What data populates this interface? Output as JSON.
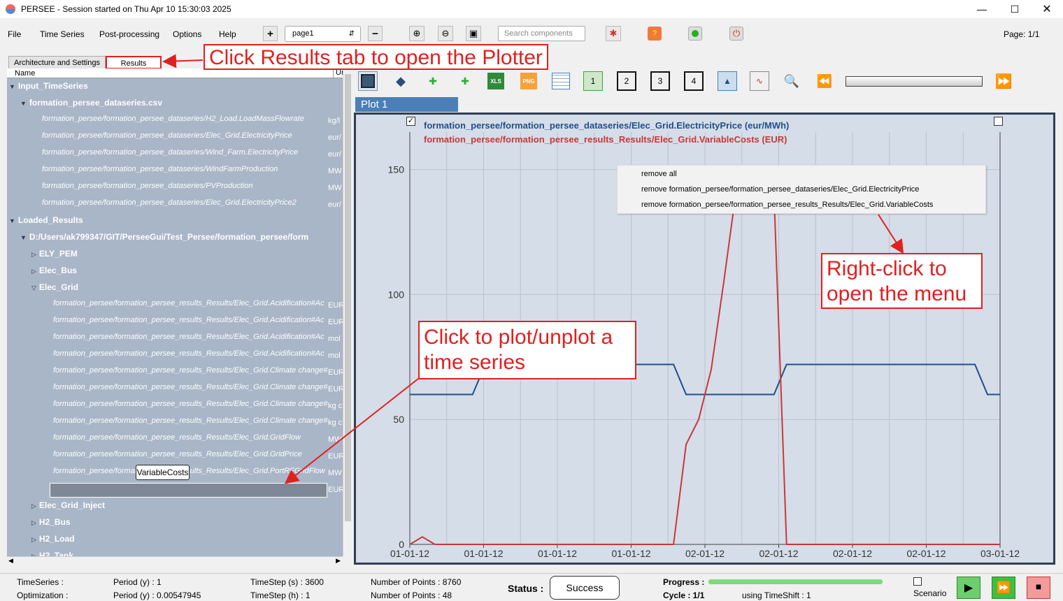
{
  "window": {
    "title": "PERSEE - Session started on Thu Apr 10 15:30:03 2025"
  },
  "menu": [
    "File",
    "Time Series",
    "Post-processing",
    "Options",
    "Help"
  ],
  "toolbar": {
    "page_select": "page1",
    "search_placeholder": "Search components",
    "page_info": "Page: 1/1"
  },
  "tabs": [
    {
      "label": "Architecture and Settings"
    },
    {
      "label": "Results"
    }
  ],
  "tree": {
    "col_name": "Name",
    "col_unit": "Ur",
    "input_root": "Input_TimeSeries",
    "input_file": "formation_persee_dataseries.csv",
    "inputs": [
      {
        "name": "formation_persee/formation_persee_dataseries/H2_Load.LoadMassFlowrate",
        "unit": "kg/l"
      },
      {
        "name": "formation_persee/formation_persee_dataseries/Elec_Grid.ElectricityPrice",
        "unit": "eur/"
      },
      {
        "name": "formation_persee/formation_persee_dataseries/Wind_Farm.ElectricityPrice",
        "unit": "eur/"
      },
      {
        "name": "formation_persee/formation_persee_dataseries/WindFarmProduction",
        "unit": "MW"
      },
      {
        "name": "formation_persee/formation_persee_dataseries/PVProduction",
        "unit": "MW"
      },
      {
        "name": "formation_persee/formation_persee_dataseries/Elec_Grid.ElectricityPrice2",
        "unit": "eur/"
      }
    ],
    "results_root": "Loaded_Results",
    "results_path": "D:/Users/ak799347/GIT/PerseeGui/Test_Persee/formation_persee/form",
    "components_before": [
      "ELY_PEM",
      "Elec_Bus"
    ],
    "elec_grid": "Elec_Grid",
    "elec_grid_items": [
      {
        "name": "formation_persee/formation_persee_results_Results/Elec_Grid.Acidification#Ac",
        "unit": "EUR"
      },
      {
        "name": "formation_persee/formation_persee_results_Results/Elec_Grid.Acidification#Ac",
        "unit": "EUR"
      },
      {
        "name": "formation_persee/formation_persee_results_Results/Elec_Grid.Acidification#Ac",
        "unit": "mol"
      },
      {
        "name": "formation_persee/formation_persee_results_Results/Elec_Grid.Acidification#Ac",
        "unit": "mol"
      },
      {
        "name": "formation_persee/formation_persee_results_Results/Elec_Grid.Climate change#",
        "unit": "EUR"
      },
      {
        "name": "formation_persee/formation_persee_results_Results/Elec_Grid.Climate change#",
        "unit": "EUR"
      },
      {
        "name": "formation_persee/formation_persee_results_Results/Elec_Grid.Climate change#",
        "unit": "kg c"
      },
      {
        "name": "formation_persee/formation_persee_results_Results/Elec_Grid.Climate change#",
        "unit": "kg c"
      },
      {
        "name": "formation_persee/formation_persee_results_Results/Elec_Grid.GridFlow",
        "unit": "MW"
      },
      {
        "name": "formation_persee/formation_persee_results_Results/Elec_Grid.GridPrice",
        "unit": "EUR"
      },
      {
        "name": "formation_persee/formation_persee_results_Results/Elec_Grid.PortRFGridFlow",
        "unit": "MW"
      },
      {
        "name": "formation_persee/formation_persee_results_Results/Elec_Grid.VariableCosts",
        "unit": "EUR"
      }
    ],
    "components_after": [
      "Elec_Grid_Inject",
      "H2_Bus",
      "H2_Load",
      "H2_Tank"
    ],
    "tooltip": "VariableCosts"
  },
  "plot": {
    "tab": "Plot 1",
    "tool_numbers": [
      "1",
      "2",
      "3",
      "4"
    ],
    "legend": [
      {
        "label": "formation_persee/formation_persee_dataseries/Elec_Grid.ElectricityPrice (eur/MWh)",
        "color": "#1f4e8c"
      },
      {
        "label": "formation_persee/formation_persee_results_Results/Elec_Grid.VariableCosts (EUR)",
        "color": "#c8383a"
      }
    ],
    "context_menu": [
      "remove all",
      "remove formation_persee/formation_persee_dataseries/Elec_Grid.ElectricityPrice",
      "remove formation_persee/formation_persee_results_Results/Elec_Grid.VariableCosts"
    ]
  },
  "chart_data": {
    "type": "line",
    "x": [
      0,
      1,
      2,
      3,
      4,
      5,
      6,
      7,
      8,
      9,
      10,
      11,
      12,
      13,
      14,
      15,
      16,
      17,
      18,
      19,
      20,
      21,
      22,
      23,
      24,
      25,
      26,
      27,
      28,
      29,
      30,
      31,
      32,
      33,
      34,
      35,
      36,
      37,
      38,
      39,
      40,
      41,
      42,
      43,
      44,
      45,
      46,
      47
    ],
    "x_ticks": [
      "01-01-12",
      "01-01-12",
      "01-01-12",
      "01-01-12",
      "02-01-12",
      "02-01-12",
      "02-01-12",
      "02-01-12",
      "03-01-12"
    ],
    "y_ticks": [
      "0",
      "50",
      "100",
      "150"
    ],
    "ylim": [
      0,
      165
    ],
    "series": [
      {
        "name": "formation_persee/formation_persee_dataseries/Elec_Grid.ElectricityPrice (eur/MWh)",
        "color": "#1f4e8c",
        "values": [
          60,
          60,
          60,
          60,
          60,
          60,
          72,
          72,
          72,
          72,
          72,
          72,
          72,
          72,
          72,
          72,
          72,
          72,
          72,
          72,
          72,
          72,
          60,
          60,
          60,
          60,
          60,
          60,
          60,
          60,
          72,
          72,
          72,
          72,
          72,
          72,
          72,
          72,
          72,
          72,
          72,
          72,
          72,
          72,
          72,
          72,
          60,
          60
        ]
      },
      {
        "name": "formation_persee/formation_persee_results_Results/Elec_Grid.VariableCosts (EUR)",
        "color": "#c8383a",
        "values": [
          0,
          3,
          0,
          0,
          0,
          0,
          0,
          0,
          0,
          0,
          0,
          0,
          0,
          0,
          0,
          0,
          0,
          0,
          0,
          0,
          0,
          0,
          40,
          50,
          70,
          105,
          142,
          148,
          147,
          140,
          0,
          0,
          0,
          0,
          0,
          0,
          0,
          0,
          0,
          0,
          0,
          0,
          0,
          0,
          0,
          0,
          0,
          0
        ]
      }
    ]
  },
  "annotations": {
    "results_tab": "Click Results tab to open the Plotter",
    "right_click": [
      "Right-click to",
      "open the menu"
    ],
    "plot_click": [
      "Click to plot/unplot a",
      "time series"
    ]
  },
  "status": {
    "timeseries_label": "TimeSeries :",
    "optimization_label": "Optimization :",
    "period_y1": "Period (y) : 1",
    "period_y2": "Period (y) : 0.00547945",
    "timestep_s": "TimeStep (s) : 3600",
    "timestep_h": "TimeStep (h) : 1",
    "points1": "Number of Points : 8760",
    "points2": "Number of Points : 48",
    "status_label": "Status :",
    "status_value": "Success",
    "progress_label": "Progress :",
    "cycle": "Cycle : 1/1",
    "timeshift": "using TimeShift : 1",
    "scenario": "Scenario"
  }
}
